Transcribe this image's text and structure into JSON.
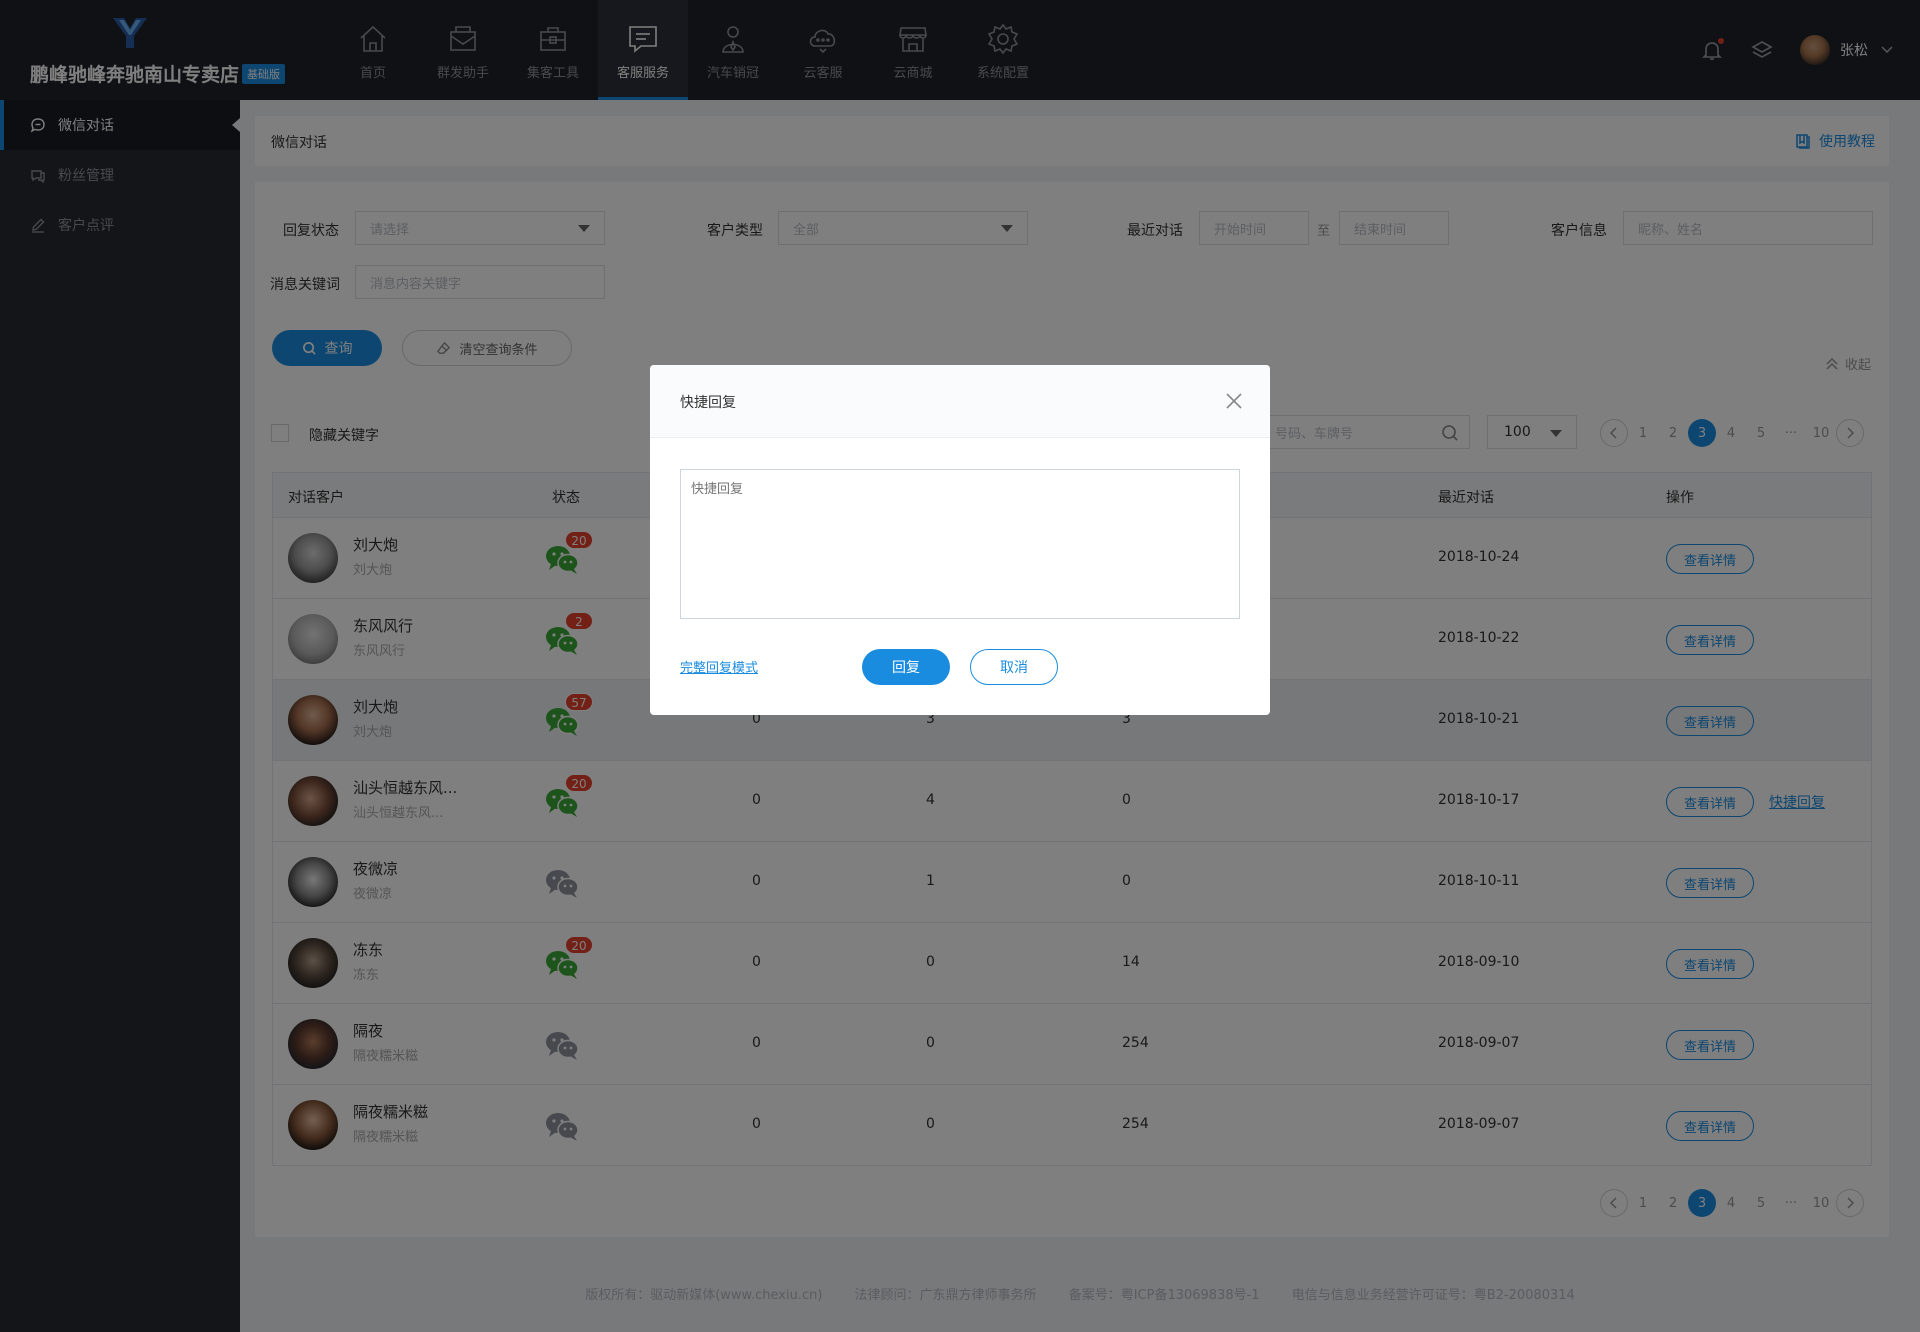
{
  "header": {
    "shop_name": "鹏峰驰峰奔驰南山专卖店",
    "edition": "基础版",
    "nav": [
      {
        "label": "首页",
        "icon": "home-icon"
      },
      {
        "label": "群发助手",
        "icon": "mail-icon"
      },
      {
        "label": "集客工具",
        "icon": "toolbox-icon"
      },
      {
        "label": "客服服务",
        "icon": "chat-icon",
        "active": true
      },
      {
        "label": "汽车销冠",
        "icon": "salesman-icon"
      },
      {
        "label": "云客服",
        "icon": "cloud-service-icon"
      },
      {
        "label": "云商城",
        "icon": "store-icon"
      },
      {
        "label": "系统配置",
        "icon": "gear-icon"
      }
    ],
    "user_name": "张松"
  },
  "sidebar": {
    "items": [
      {
        "label": "微信对话",
        "icon": "chat-bubble-icon",
        "active": true
      },
      {
        "label": "粉丝管理",
        "icon": "fans-icon"
      },
      {
        "label": "客户点评",
        "icon": "pen-icon"
      }
    ]
  },
  "breadcrumb": {
    "title": "微信对话",
    "tutorial": "使用教程"
  },
  "filters": {
    "reply_status_label": "回复状态",
    "reply_status_placeholder": "请选择",
    "customer_type_label": "客户类型",
    "customer_type_value": "全部",
    "recent_label": "最近对话",
    "start_placeholder": "开始时间",
    "to": "至",
    "end_placeholder": "结束时间",
    "customer_info_label": "客户信息",
    "customer_info_placeholder": "昵称、姓名",
    "keyword_label": "消息关键词",
    "keyword_placeholder": "消息内容关键字",
    "query_button": "查询",
    "clear_button": "清空查询条件",
    "collapse": "收起"
  },
  "toolbar": {
    "hide_keyword": "隐藏关键字",
    "search_placeholder": "号码、车牌号",
    "page_size": "100"
  },
  "pagination": {
    "pages": [
      "1",
      "2",
      "3",
      "4",
      "5",
      "···",
      "10"
    ],
    "current": "3"
  },
  "table": {
    "headers": {
      "customer": "对话客户",
      "status": "状态",
      "recent": "最近对话",
      "action": "操作"
    },
    "detail_label": "查看详情",
    "quick_reply_label": "快捷回复",
    "rows": [
      {
        "name": "刘大炮",
        "sub": "刘大炮",
        "badge": "20",
        "active": true,
        "c1": "",
        "c2": "",
        "c3": "",
        "date": "2018-10-24",
        "quick": false
      },
      {
        "name": "东风风行",
        "sub": "东风风行",
        "badge": "2",
        "active": true,
        "c1": "",
        "c2": "",
        "c3": "",
        "date": "2018-10-22",
        "quick": false
      },
      {
        "name": "刘大炮",
        "sub": "刘大炮",
        "badge": "57",
        "active": true,
        "c1": "0",
        "c2": "3",
        "c3": "3",
        "date": "2018-10-21",
        "quick": false
      },
      {
        "name": "汕头恒越东风...",
        "sub": "汕头恒越东风...",
        "badge": "20",
        "active": true,
        "c1": "0",
        "c2": "4",
        "c3": "0",
        "date": "2018-10-17",
        "quick": true
      },
      {
        "name": "夜微凉",
        "sub": "夜微凉",
        "badge": "",
        "active": false,
        "c1": "0",
        "c2": "1",
        "c3": "0",
        "date": "2018-10-11",
        "quick": false
      },
      {
        "name": "冻东",
        "sub": "冻东",
        "badge": "20",
        "active": true,
        "c1": "0",
        "c2": "0",
        "c3": "14",
        "date": "2018-09-10",
        "quick": false
      },
      {
        "name": "隔夜",
        "sub": "隔夜糯米糍",
        "badge": "",
        "active": false,
        "c1": "0",
        "c2": "0",
        "c3": "254",
        "date": "2018-09-07",
        "quick": false
      },
      {
        "name": "隔夜糯米糍",
        "sub": "隔夜糯米糍",
        "badge": "",
        "active": false,
        "c1": "0",
        "c2": "0",
        "c3": "254",
        "date": "2018-09-07",
        "quick": false
      }
    ]
  },
  "footer": {
    "copyright": "版权所有：驱动新媒体(www.chexiu.cn)",
    "legal": "法律顾问：广东鼎方律师事务所",
    "icp": "备案号：粤ICP备13069838号-1",
    "license": "电信与信息业务经营许可证号：粤B2-20080314"
  },
  "modal": {
    "title": "快捷回复",
    "placeholder": "快捷回复",
    "full_mode": "完整回复模式",
    "reply_button": "回复",
    "cancel_button": "取消"
  },
  "colors": {
    "accent": "#1a8ce0",
    "topbar": "#20232b",
    "sidebar": "#262a33",
    "badge": "#e6402c",
    "wechat_active": "#3aa936",
    "wechat_inactive": "#8e939c"
  }
}
